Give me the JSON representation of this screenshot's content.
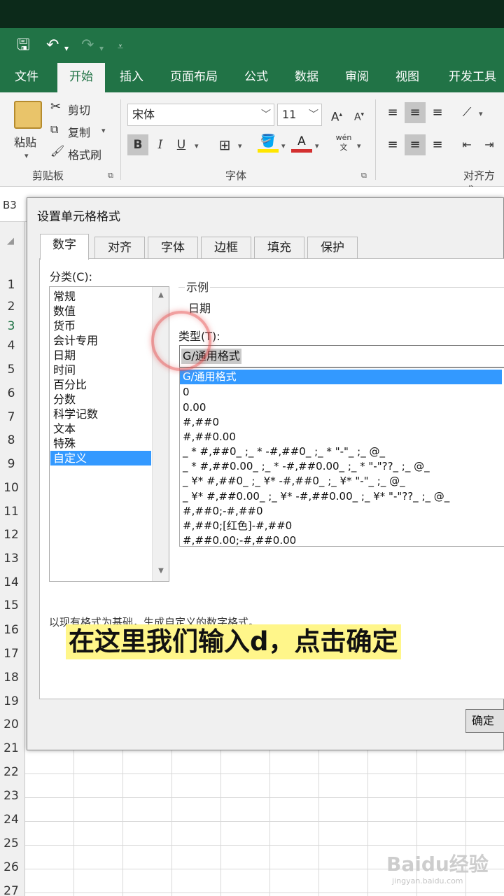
{
  "colors": {
    "brand": "#217346",
    "selection": "#3399ff",
    "caption_bg": "#fff68a"
  },
  "ribbon_tabs": [
    "文件",
    "开始",
    "插入",
    "页面布局",
    "公式",
    "数据",
    "审阅",
    "视图",
    "开发工具"
  ],
  "ribbon": {
    "paste_label": "粘贴",
    "cut_label": "剪切",
    "copy_label": "复制",
    "format_painter_label": "格式刷",
    "clipboard_group": "剪贴板",
    "font_name": "宋体",
    "font_size": "11",
    "font_group": "字体",
    "align_group": "对齐方式"
  },
  "name_box": "B3",
  "row_numbers": [
    "1",
    "2",
    "3",
    "4",
    "5",
    "6",
    "7",
    "8",
    "9",
    "10",
    "11",
    "12",
    "13",
    "14",
    "15",
    "16",
    "17",
    "18",
    "19",
    "20",
    "21",
    "22",
    "23",
    "24",
    "25",
    "26",
    "27"
  ],
  "dialog": {
    "title": "设置单元格格式",
    "tabs": [
      "数字",
      "对齐",
      "字体",
      "边框",
      "填充",
      "保护"
    ],
    "category_label": "分类(C):",
    "categories": [
      "常规",
      "数值",
      "货币",
      "会计专用",
      "日期",
      "时间",
      "百分比",
      "分数",
      "科学记数",
      "文本",
      "特殊",
      "自定义"
    ],
    "selected_category": "自定义",
    "sample_label": "示例",
    "sample_value": "日期",
    "type_label": "类型(T):",
    "type_value": "G/通用格式",
    "formats": [
      "G/通用格式",
      "0",
      "0.00",
      "#,##0",
      "#,##0.00",
      "_ * #,##0_ ;_ * -#,##0_ ;_ * \"-\"_ ;_ @_",
      "_ * #,##0.00_ ;_ * -#,##0.00_ ;_ * \"-\"??_ ;_ @_",
      "_ ¥* #,##0_ ;_ ¥* -#,##0_ ;_ ¥* \"-\"_ ;_ @_",
      "_ ¥* #,##0.00_ ;_ ¥* -#,##0.00_ ;_ ¥* \"-\"??_ ;_ @_",
      "#,##0;-#,##0",
      "#,##0;[红色]-#,##0",
      "#,##0.00;-#,##0.00"
    ],
    "hint": "以现有格式为基础，生成自定义的数字格式。",
    "ok_label": "确定"
  },
  "caption": "在这里我们输入d，点击确定",
  "watermark": "Baidu经验",
  "watermark_sub": "jingyan.baidu.com"
}
